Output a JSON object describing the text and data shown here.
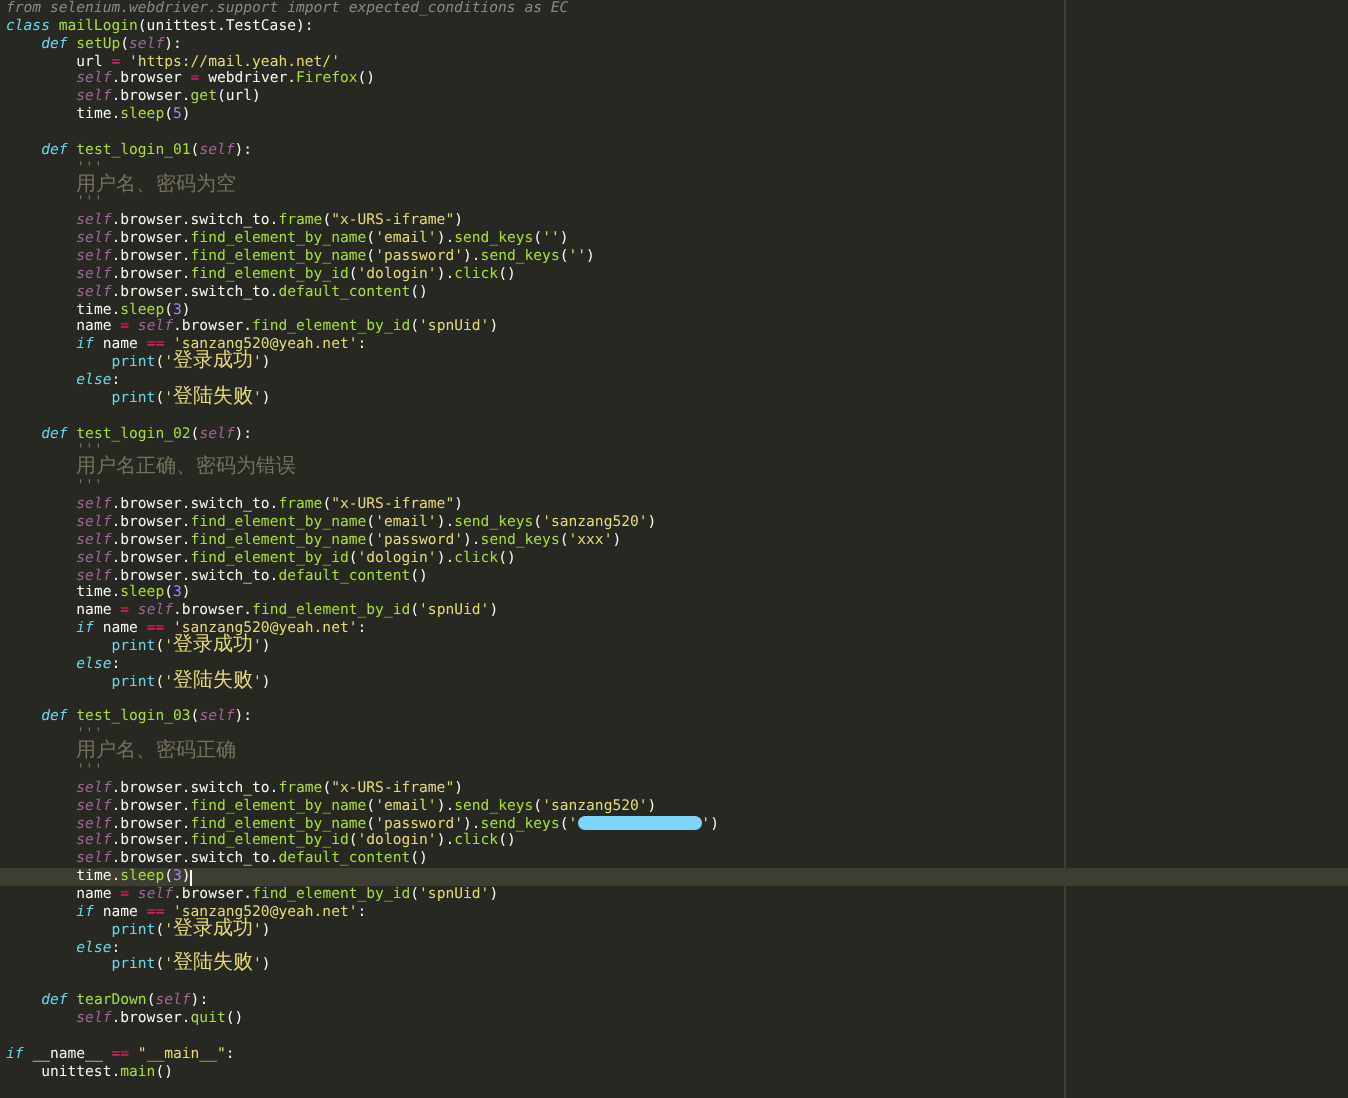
{
  "editor": {
    "lines": [
      {
        "current": false,
        "tokens": [
          {
            "text": "from selenium.webdriver.support import expected_conditions as EC",
            "kind": "dim"
          }
        ]
      },
      {
        "current": false,
        "tokens": [
          {
            "text": "class ",
            "kind": "kw"
          },
          {
            "text": "mailLogin",
            "kind": "def"
          },
          {
            "text": "(unittest.TestCase):",
            "kind": "plain"
          }
        ]
      },
      {
        "current": false,
        "tokens": [
          {
            "text": "    def ",
            "kind": "kw"
          },
          {
            "text": "setUp",
            "kind": "def"
          },
          {
            "text": "(",
            "kind": "plain"
          },
          {
            "text": "self",
            "kind": "self"
          },
          {
            "text": "):",
            "kind": "plain"
          }
        ]
      },
      {
        "current": false,
        "tokens": [
          {
            "text": "        url ",
            "kind": "plain"
          },
          {
            "text": "= ",
            "kind": "op"
          },
          {
            "text": "'https://mail.yeah.net/'",
            "kind": "str"
          }
        ]
      },
      {
        "current": false,
        "tokens": [
          {
            "text": "        self",
            "kind": "self"
          },
          {
            "text": ".browser ",
            "kind": "plain"
          },
          {
            "text": "=",
            "kind": "op"
          },
          {
            "text": " webdriver.",
            "kind": "plain"
          },
          {
            "text": "Firefox",
            "kind": "call"
          },
          {
            "text": "()",
            "kind": "plain"
          }
        ]
      },
      {
        "current": false,
        "tokens": [
          {
            "text": "        self",
            "kind": "self"
          },
          {
            "text": ".browser.",
            "kind": "plain"
          },
          {
            "text": "get",
            "kind": "call"
          },
          {
            "text": "(url)",
            "kind": "plain"
          }
        ]
      },
      {
        "current": false,
        "tokens": [
          {
            "text": "        time.",
            "kind": "plain"
          },
          {
            "text": "sleep",
            "kind": "call"
          },
          {
            "text": "(",
            "kind": "plain"
          },
          {
            "text": "5",
            "kind": "num"
          },
          {
            "text": ")",
            "kind": "plain"
          }
        ]
      },
      {
        "current": false
      },
      {
        "current": false,
        "tokens": [
          {
            "text": "    def ",
            "kind": "kw"
          },
          {
            "text": "test_login_01",
            "kind": "def"
          },
          {
            "text": "(",
            "kind": "plain"
          },
          {
            "text": "self",
            "kind": "self"
          },
          {
            "text": "):",
            "kind": "plain"
          }
        ]
      },
      {
        "current": false,
        "tokens": [
          {
            "text": "        '''",
            "kind": "comment"
          }
        ]
      },
      {
        "current": false,
        "tokens": [
          {
            "text": "        用户名、密码为空",
            "kind": "comment"
          }
        ]
      },
      {
        "current": false,
        "tokens": [
          {
            "text": "        '''",
            "kind": "comment"
          }
        ]
      },
      {
        "current": false,
        "tokens": [
          {
            "text": "        self",
            "kind": "self"
          },
          {
            "text": ".browser.switch_to.",
            "kind": "plain"
          },
          {
            "text": "frame",
            "kind": "call"
          },
          {
            "text": "(",
            "kind": "plain"
          },
          {
            "text": "\"x-URS-iframe\"",
            "kind": "str"
          },
          {
            "text": ")",
            "kind": "plain"
          }
        ]
      },
      {
        "current": false,
        "tokens": [
          {
            "text": "        self",
            "kind": "self"
          },
          {
            "text": ".browser.",
            "kind": "plain"
          },
          {
            "text": "find_element_by_name",
            "kind": "call"
          },
          {
            "text": "(",
            "kind": "plain"
          },
          {
            "text": "'email'",
            "kind": "str"
          },
          {
            "text": ").",
            "kind": "plain"
          },
          {
            "text": "send_keys",
            "kind": "call"
          },
          {
            "text": "(",
            "kind": "plain"
          },
          {
            "text": "''",
            "kind": "str"
          },
          {
            "text": ")",
            "kind": "plain"
          }
        ]
      },
      {
        "current": false,
        "tokens": [
          {
            "text": "        self",
            "kind": "self"
          },
          {
            "text": ".browser.",
            "kind": "plain"
          },
          {
            "text": "find_element_by_name",
            "kind": "call"
          },
          {
            "text": "(",
            "kind": "plain"
          },
          {
            "text": "'password'",
            "kind": "str"
          },
          {
            "text": ").",
            "kind": "plain"
          },
          {
            "text": "send_keys",
            "kind": "call"
          },
          {
            "text": "(",
            "kind": "plain"
          },
          {
            "text": "''",
            "kind": "str"
          },
          {
            "text": ")",
            "kind": "plain"
          }
        ]
      },
      {
        "current": false,
        "tokens": [
          {
            "text": "        self",
            "kind": "self"
          },
          {
            "text": ".browser.",
            "kind": "plain"
          },
          {
            "text": "find_element_by_id",
            "kind": "call"
          },
          {
            "text": "(",
            "kind": "plain"
          },
          {
            "text": "'dologin'",
            "kind": "str"
          },
          {
            "text": ").",
            "kind": "plain"
          },
          {
            "text": "click",
            "kind": "call"
          },
          {
            "text": "()",
            "kind": "plain"
          }
        ]
      },
      {
        "current": false,
        "tokens": [
          {
            "text": "        self",
            "kind": "self"
          },
          {
            "text": ".browser.switch_to.",
            "kind": "plain"
          },
          {
            "text": "default_content",
            "kind": "call"
          },
          {
            "text": "()",
            "kind": "plain"
          }
        ]
      },
      {
        "current": false,
        "tokens": [
          {
            "text": "        time.",
            "kind": "plain"
          },
          {
            "text": "sleep",
            "kind": "call"
          },
          {
            "text": "(",
            "kind": "plain"
          },
          {
            "text": "3",
            "kind": "num"
          },
          {
            "text": ")",
            "kind": "plain"
          }
        ]
      },
      {
        "current": false,
        "tokens": [
          {
            "text": "        name ",
            "kind": "plain"
          },
          {
            "text": "= ",
            "kind": "op"
          },
          {
            "text": "self",
            "kind": "self"
          },
          {
            "text": ".browser.",
            "kind": "plain"
          },
          {
            "text": "find_element_by_id",
            "kind": "call"
          },
          {
            "text": "(",
            "kind": "plain"
          },
          {
            "text": "'spnUid'",
            "kind": "str"
          },
          {
            "text": ")",
            "kind": "plain"
          }
        ]
      },
      {
        "current": false,
        "tokens": [
          {
            "text": "        if",
            "kind": "kw"
          },
          {
            "text": " name ",
            "kind": "plain"
          },
          {
            "text": "== ",
            "kind": "op"
          },
          {
            "text": "'sanzang520@yeah.net'",
            "kind": "str"
          },
          {
            "text": ":",
            "kind": "plain"
          }
        ]
      },
      {
        "current": false,
        "tokens": [
          {
            "text": "            print",
            "kind": "builtin"
          },
          {
            "text": "(",
            "kind": "plain"
          },
          {
            "text": "'",
            "kind": "str"
          },
          {
            "text": "登录成功",
            "kind": "str"
          },
          {
            "text": "'",
            "kind": "str"
          },
          {
            "text": ")",
            "kind": "plain"
          }
        ]
      },
      {
        "current": false,
        "tokens": [
          {
            "text": "        else",
            "kind": "kw"
          },
          {
            "text": ":",
            "kind": "plain"
          }
        ]
      },
      {
        "current": false,
        "tokens": [
          {
            "text": "            print",
            "kind": "builtin"
          },
          {
            "text": "(",
            "kind": "plain"
          },
          {
            "text": "'",
            "kind": "str"
          },
          {
            "text": "登陆失败",
            "kind": "str"
          },
          {
            "text": "'",
            "kind": "str"
          },
          {
            "text": ")",
            "kind": "plain"
          }
        ]
      },
      {
        "current": false
      },
      {
        "current": false,
        "tokens": [
          {
            "text": "    def ",
            "kind": "kw"
          },
          {
            "text": "test_login_02",
            "kind": "def"
          },
          {
            "text": "(",
            "kind": "plain"
          },
          {
            "text": "self",
            "kind": "self"
          },
          {
            "text": "):",
            "kind": "plain"
          }
        ]
      },
      {
        "current": false,
        "tokens": [
          {
            "text": "        '''",
            "kind": "comment"
          }
        ]
      },
      {
        "current": false,
        "tokens": [
          {
            "text": "        用户名正确、密码为错误",
            "kind": "comment"
          }
        ]
      },
      {
        "current": false,
        "tokens": [
          {
            "text": "        '''",
            "kind": "comment"
          }
        ]
      },
      {
        "current": false,
        "tokens": [
          {
            "text": "        self",
            "kind": "self"
          },
          {
            "text": ".browser.switch_to.",
            "kind": "plain"
          },
          {
            "text": "frame",
            "kind": "call"
          },
          {
            "text": "(",
            "kind": "plain"
          },
          {
            "text": "\"x-URS-iframe\"",
            "kind": "str"
          },
          {
            "text": ")",
            "kind": "plain"
          }
        ]
      },
      {
        "current": false,
        "tokens": [
          {
            "text": "        self",
            "kind": "self"
          },
          {
            "text": ".browser.",
            "kind": "plain"
          },
          {
            "text": "find_element_by_name",
            "kind": "call"
          },
          {
            "text": "(",
            "kind": "plain"
          },
          {
            "text": "'email'",
            "kind": "str"
          },
          {
            "text": ").",
            "kind": "plain"
          },
          {
            "text": "send_keys",
            "kind": "call"
          },
          {
            "text": "(",
            "kind": "plain"
          },
          {
            "text": "'sanzang520'",
            "kind": "str"
          },
          {
            "text": ")",
            "kind": "plain"
          }
        ]
      },
      {
        "current": false,
        "tokens": [
          {
            "text": "        self",
            "kind": "self"
          },
          {
            "text": ".browser.",
            "kind": "plain"
          },
          {
            "text": "find_element_by_name",
            "kind": "call"
          },
          {
            "text": "(",
            "kind": "plain"
          },
          {
            "text": "'password'",
            "kind": "str"
          },
          {
            "text": ").",
            "kind": "plain"
          },
          {
            "text": "send_keys",
            "kind": "call"
          },
          {
            "text": "(",
            "kind": "plain"
          },
          {
            "text": "'xxx'",
            "kind": "str"
          },
          {
            "text": ")",
            "kind": "plain"
          }
        ]
      },
      {
        "current": false,
        "tokens": [
          {
            "text": "        self",
            "kind": "self"
          },
          {
            "text": ".browser.",
            "kind": "plain"
          },
          {
            "text": "find_element_by_id",
            "kind": "call"
          },
          {
            "text": "(",
            "kind": "plain"
          },
          {
            "text": "'dologin'",
            "kind": "str"
          },
          {
            "text": ").",
            "kind": "plain"
          },
          {
            "text": "click",
            "kind": "call"
          },
          {
            "text": "()",
            "kind": "plain"
          }
        ]
      },
      {
        "current": false,
        "tokens": [
          {
            "text": "        self",
            "kind": "self"
          },
          {
            "text": ".browser.switch_to.",
            "kind": "plain"
          },
          {
            "text": "default_content",
            "kind": "call"
          },
          {
            "text": "()",
            "kind": "plain"
          }
        ]
      },
      {
        "current": false,
        "tokens": [
          {
            "text": "        time.",
            "kind": "plain"
          },
          {
            "text": "sleep",
            "kind": "call"
          },
          {
            "text": "(",
            "kind": "plain"
          },
          {
            "text": "3",
            "kind": "num"
          },
          {
            "text": ")",
            "kind": "plain"
          }
        ]
      },
      {
        "current": false,
        "tokens": [
          {
            "text": "        name ",
            "kind": "plain"
          },
          {
            "text": "= ",
            "kind": "op"
          },
          {
            "text": "self",
            "kind": "self"
          },
          {
            "text": ".browser.",
            "kind": "plain"
          },
          {
            "text": "find_element_by_id",
            "kind": "call"
          },
          {
            "text": "(",
            "kind": "plain"
          },
          {
            "text": "'spnUid'",
            "kind": "str"
          },
          {
            "text": ")",
            "kind": "plain"
          }
        ]
      },
      {
        "current": false,
        "tokens": [
          {
            "text": "        if",
            "kind": "kw"
          },
          {
            "text": " name ",
            "kind": "plain"
          },
          {
            "text": "== ",
            "kind": "op"
          },
          {
            "text": "'sanzang520@yeah.net'",
            "kind": "str"
          },
          {
            "text": ":",
            "kind": "plain"
          }
        ]
      },
      {
        "current": false,
        "tokens": [
          {
            "text": "            print",
            "kind": "builtin"
          },
          {
            "text": "(",
            "kind": "plain"
          },
          {
            "text": "'",
            "kind": "str"
          },
          {
            "text": "登录成功",
            "kind": "str"
          },
          {
            "text": "'",
            "kind": "str"
          },
          {
            "text": ")",
            "kind": "plain"
          }
        ]
      },
      {
        "current": false,
        "tokens": [
          {
            "text": "        else",
            "kind": "kw"
          },
          {
            "text": ":",
            "kind": "plain"
          }
        ]
      },
      {
        "current": false,
        "tokens": [
          {
            "text": "            print",
            "kind": "builtin"
          },
          {
            "text": "(",
            "kind": "plain"
          },
          {
            "text": "'",
            "kind": "str"
          },
          {
            "text": "登陆失败",
            "kind": "str"
          },
          {
            "text": "'",
            "kind": "str"
          },
          {
            "text": ")",
            "kind": "plain"
          }
        ]
      },
      {
        "current": false
      },
      {
        "current": false,
        "tokens": [
          {
            "text": "    def ",
            "kind": "kw"
          },
          {
            "text": "test_login_03",
            "kind": "def"
          },
          {
            "text": "(",
            "kind": "plain"
          },
          {
            "text": "self",
            "kind": "self"
          },
          {
            "text": "):",
            "kind": "plain"
          }
        ]
      },
      {
        "current": false,
        "tokens": [
          {
            "text": "        '''",
            "kind": "comment"
          }
        ]
      },
      {
        "current": false,
        "tokens": [
          {
            "text": "        用户名、密码正确",
            "kind": "comment"
          }
        ]
      },
      {
        "current": false,
        "tokens": [
          {
            "text": "        '''",
            "kind": "comment"
          }
        ]
      },
      {
        "current": false,
        "tokens": [
          {
            "text": "        self",
            "kind": "self"
          },
          {
            "text": ".browser.switch_to.",
            "kind": "plain"
          },
          {
            "text": "frame",
            "kind": "call"
          },
          {
            "text": "(",
            "kind": "plain"
          },
          {
            "text": "\"x-URS-iframe\"",
            "kind": "str"
          },
          {
            "text": ")",
            "kind": "plain"
          }
        ]
      },
      {
        "current": false,
        "tokens": [
          {
            "text": "        self",
            "kind": "self"
          },
          {
            "text": ".browser.",
            "kind": "plain"
          },
          {
            "text": "find_element_by_name",
            "kind": "call"
          },
          {
            "text": "(",
            "kind": "plain"
          },
          {
            "text": "'email'",
            "kind": "str"
          },
          {
            "text": ").",
            "kind": "plain"
          },
          {
            "text": "send_keys",
            "kind": "call"
          },
          {
            "text": "(",
            "kind": "plain"
          },
          {
            "text": "'sanzang520'",
            "kind": "str"
          },
          {
            "text": ")",
            "kind": "plain"
          }
        ]
      },
      {
        "current": false,
        "tokens": [
          {
            "text": "        self",
            "kind": "self"
          },
          {
            "text": ".browser.",
            "kind": "plain"
          },
          {
            "text": "find_element_by_name",
            "kind": "call"
          },
          {
            "text": "(",
            "kind": "plain"
          },
          {
            "text": "'password'",
            "kind": "str"
          },
          {
            "text": ").",
            "kind": "plain"
          },
          {
            "text": "send_keys",
            "kind": "call"
          },
          {
            "text": "(",
            "kind": "plain"
          },
          {
            "text": "'",
            "kind": "str"
          },
          {
            "kind": "redacted"
          },
          {
            "text": "'",
            "kind": "str"
          },
          {
            "text": ")",
            "kind": "plain"
          }
        ]
      },
      {
        "current": false,
        "tokens": [
          {
            "text": "        self",
            "kind": "self"
          },
          {
            "text": ".browser.",
            "kind": "plain"
          },
          {
            "text": "find_element_by_id",
            "kind": "call"
          },
          {
            "text": "(",
            "kind": "plain"
          },
          {
            "text": "'dologin'",
            "kind": "str"
          },
          {
            "text": ").",
            "kind": "plain"
          },
          {
            "text": "click",
            "kind": "call"
          },
          {
            "text": "()",
            "kind": "plain"
          }
        ]
      },
      {
        "current": false,
        "tokens": [
          {
            "text": "        self",
            "kind": "self"
          },
          {
            "text": ".browser.switch_to.",
            "kind": "plain"
          },
          {
            "text": "default_content",
            "kind": "call"
          },
          {
            "text": "()",
            "kind": "plain"
          }
        ]
      },
      {
        "current": true,
        "tokens": [
          {
            "text": "        time.",
            "kind": "plain"
          },
          {
            "text": "sleep",
            "kind": "call"
          },
          {
            "text": "(",
            "kind": "plain"
          },
          {
            "text": "3",
            "kind": "num"
          },
          {
            "text": ")",
            "kind": "plain"
          }
        ]
      },
      {
        "current": false,
        "tokens": [
          {
            "text": "        name ",
            "kind": "plain"
          },
          {
            "text": "= ",
            "kind": "op"
          },
          {
            "text": "self",
            "kind": "self"
          },
          {
            "text": ".browser.",
            "kind": "plain"
          },
          {
            "text": "find_element_by_id",
            "kind": "call"
          },
          {
            "text": "(",
            "kind": "plain"
          },
          {
            "text": "'spnUid'",
            "kind": "str"
          },
          {
            "text": ")",
            "kind": "plain"
          }
        ]
      },
      {
        "current": false,
        "tokens": [
          {
            "text": "        if",
            "kind": "kw"
          },
          {
            "text": " name ",
            "kind": "plain"
          },
          {
            "text": "== ",
            "kind": "op"
          },
          {
            "text": "'sanzang520@yeah.net'",
            "kind": "str"
          },
          {
            "text": ":",
            "kind": "plain"
          }
        ]
      },
      {
        "current": false,
        "tokens": [
          {
            "text": "            print",
            "kind": "builtin"
          },
          {
            "text": "(",
            "kind": "plain"
          },
          {
            "text": "'",
            "kind": "str"
          },
          {
            "text": "登录成功",
            "kind": "str"
          },
          {
            "text": "'",
            "kind": "str"
          },
          {
            "text": ")",
            "kind": "plain"
          }
        ]
      },
      {
        "current": false,
        "tokens": [
          {
            "text": "        else",
            "kind": "kw"
          },
          {
            "text": ":",
            "kind": "plain"
          }
        ]
      },
      {
        "current": false,
        "tokens": [
          {
            "text": "            print",
            "kind": "builtin"
          },
          {
            "text": "(",
            "kind": "plain"
          },
          {
            "text": "'",
            "kind": "str"
          },
          {
            "text": "登陆失败",
            "kind": "str"
          },
          {
            "text": "'",
            "kind": "str"
          },
          {
            "text": ")",
            "kind": "plain"
          }
        ]
      },
      {
        "current": false
      },
      {
        "current": false,
        "tokens": [
          {
            "text": "    def ",
            "kind": "kw"
          },
          {
            "text": "tearDown",
            "kind": "def"
          },
          {
            "text": "(",
            "kind": "plain"
          },
          {
            "text": "self",
            "kind": "self"
          },
          {
            "text": "):",
            "kind": "plain"
          }
        ]
      },
      {
        "current": false,
        "tokens": [
          {
            "text": "        self",
            "kind": "self"
          },
          {
            "text": ".browser.",
            "kind": "plain"
          },
          {
            "text": "quit",
            "kind": "call"
          },
          {
            "text": "()",
            "kind": "plain"
          }
        ]
      },
      {
        "current": false
      },
      {
        "current": false,
        "tokens": [
          {
            "text": "if",
            "kind": "kw"
          },
          {
            "text": " __name__ ",
            "kind": "plain"
          },
          {
            "text": "== ",
            "kind": "op"
          },
          {
            "text": "\"__main__\"",
            "kind": "str"
          },
          {
            "text": ":",
            "kind": "plain"
          }
        ]
      },
      {
        "current": false,
        "tokens": [
          {
            "text": "    unittest.",
            "kind": "plain"
          },
          {
            "text": "main",
            "kind": "call"
          },
          {
            "text": "()",
            "kind": "plain"
          }
        ]
      }
    ]
  }
}
